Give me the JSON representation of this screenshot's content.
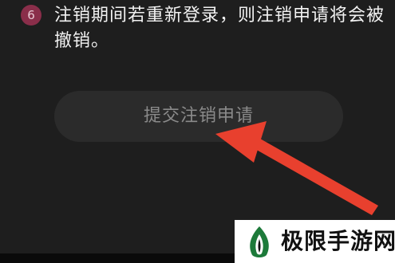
{
  "step": {
    "number": "6",
    "text": "注销期间若重新登录，则注销申请将会被撤销。"
  },
  "submit_button": {
    "label": "提交注销申请"
  },
  "watermark": {
    "text": "极限手游网",
    "logo": "leaf-logo-icon"
  },
  "colors": {
    "background": "#1e1e1e",
    "badge": "#8a2e4a",
    "button_bg": "#2b2b2b",
    "arrow": "#e8402e"
  }
}
